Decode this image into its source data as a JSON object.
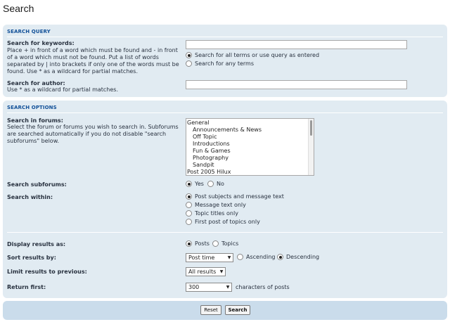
{
  "page": {
    "title": "Search"
  },
  "search_query": {
    "heading": "SEARCH QUERY",
    "keywords": {
      "label": "Search for keywords:",
      "description": "Place + in front of a word which must be found and - in front of a word which must not be found. Put a list of words separated by | into brackets if only one of the words must be found. Use * as a wildcard for partial matches.",
      "value": "",
      "options": [
        {
          "label": "Search for all terms or use query as entered",
          "selected": true
        },
        {
          "label": "Search for any terms",
          "selected": false
        }
      ]
    },
    "author": {
      "label": "Search for author:",
      "description": "Use * as a wildcard for partial matches.",
      "value": ""
    }
  },
  "search_options": {
    "heading": "SEARCH OPTIONS",
    "forums": {
      "label": "Search in forums:",
      "description": "Select the forum or forums you wish to search in. Subforums are searched automatically if you do not disable \"search subforums\" below.",
      "items": [
        {
          "label": "General",
          "indent": false
        },
        {
          "label": "Announcements & News",
          "indent": true
        },
        {
          "label": "Off Topic",
          "indent": true
        },
        {
          "label": "Introductions",
          "indent": true
        },
        {
          "label": "Fun & Games",
          "indent": true
        },
        {
          "label": "Photography",
          "indent": true
        },
        {
          "label": "Sandpit",
          "indent": true
        },
        {
          "label": "Post 2005 Hilux",
          "indent": false
        }
      ]
    },
    "subforums": {
      "label": "Search subforums:",
      "options": [
        {
          "label": "Yes",
          "selected": true
        },
        {
          "label": "No",
          "selected": false
        }
      ]
    },
    "within": {
      "label": "Search within:",
      "options": [
        {
          "label": "Post subjects and message text",
          "selected": true
        },
        {
          "label": "Message text only",
          "selected": false
        },
        {
          "label": "Topic titles only",
          "selected": false
        },
        {
          "label": "First post of topics only",
          "selected": false
        }
      ]
    },
    "display": {
      "label": "Display results as:",
      "options": [
        {
          "label": "Posts",
          "selected": true
        },
        {
          "label": "Topics",
          "selected": false
        }
      ]
    },
    "sort": {
      "label": "Sort results by:",
      "value": "Post time",
      "options": [
        {
          "label": "Ascending",
          "selected": false
        },
        {
          "label": "Descending",
          "selected": true
        }
      ]
    },
    "limit": {
      "label": "Limit results to previous:",
      "value": "All results"
    },
    "return_first": {
      "label": "Return first:",
      "value": "300",
      "suffix": "characters of posts"
    }
  },
  "buttons": {
    "reset": "Reset",
    "search": "Search"
  }
}
